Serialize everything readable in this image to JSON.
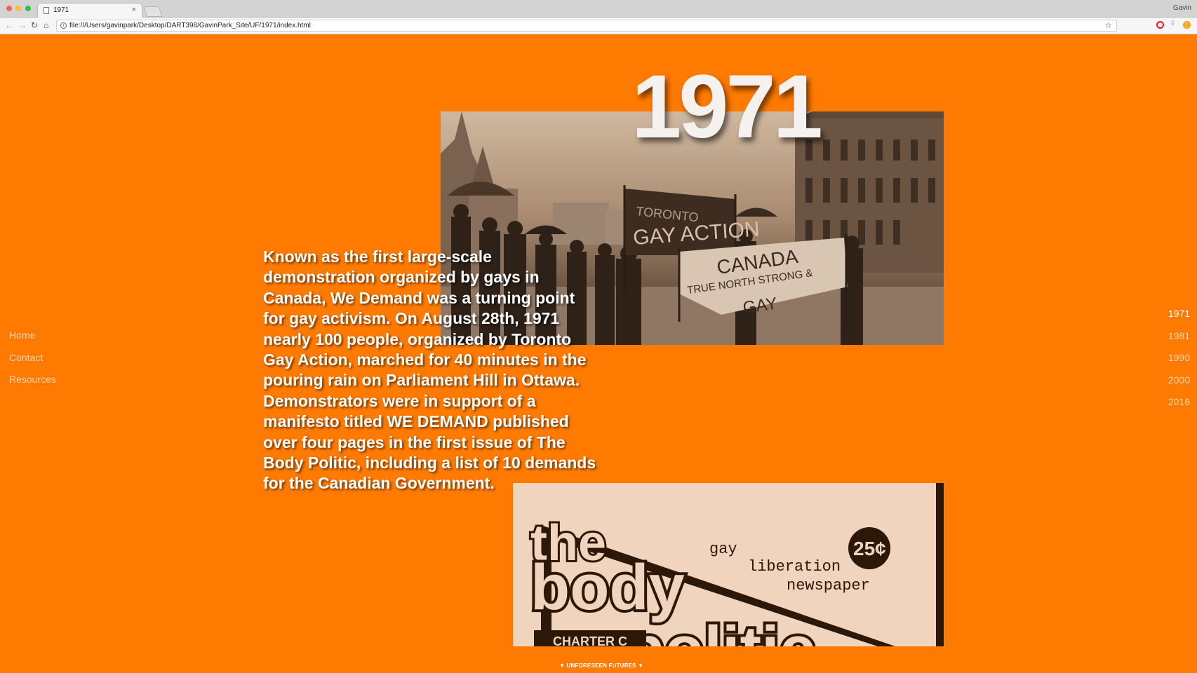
{
  "browser": {
    "tab_title": "1971",
    "tab_close": "×",
    "profile_name": "Gavin",
    "url": "file:///Users/gavinpark/Desktop/DART398/GavinPark_Site/UF/1971/index.html",
    "nav_icons": [
      "back-icon",
      "forward-icon",
      "reload-icon",
      "home-icon",
      "info-icon",
      "star-icon",
      "opera-icon",
      "download-icon",
      "warning-icon"
    ]
  },
  "page": {
    "background_color": "#ff7a00",
    "year_title": "1971",
    "body_text": "Known as the first large-scale demonstration organized by gays in Canada, We Demand was a turning point for gay activism. On August 28th, 1971 nearly 100 people, organized by Toronto Gay Action, marched for 40 minutes in the pouring rain on Parliament Hill in Ottawa. Demonstrators were in support of a manifesto titled WE DEMAND published over four pages in the first issue of The Body Politic, including a list of 10 demands for the Canadian Government.",
    "photo": {
      "banner_1": "GAY ACTION",
      "banner_1_top": "TORONTO",
      "banner_2_line1": "CANADA",
      "banner_2_line2": "TRUE NORTH STRONG &",
      "banner_2_line3": "GAY"
    },
    "magazine": {
      "title_word_1": "the",
      "title_word_2": "body",
      "title_word_3": "politic",
      "tagline_1": "gay",
      "tagline_2": "liberation",
      "tagline_3": "newspaper",
      "price": "25¢",
      "charter": "CHARTER C"
    },
    "left_nav": [
      {
        "label": "Home"
      },
      {
        "label": "Contact"
      },
      {
        "label": "Resources"
      }
    ],
    "year_nav": [
      {
        "label": "1971",
        "active": true
      },
      {
        "label": "1981",
        "active": false
      },
      {
        "label": "1990",
        "active": false
      },
      {
        "label": "2000",
        "active": false
      },
      {
        "label": "2016",
        "active": false
      }
    ],
    "footer_label": "▼ UNFORESEEN FUTURES ▼"
  }
}
